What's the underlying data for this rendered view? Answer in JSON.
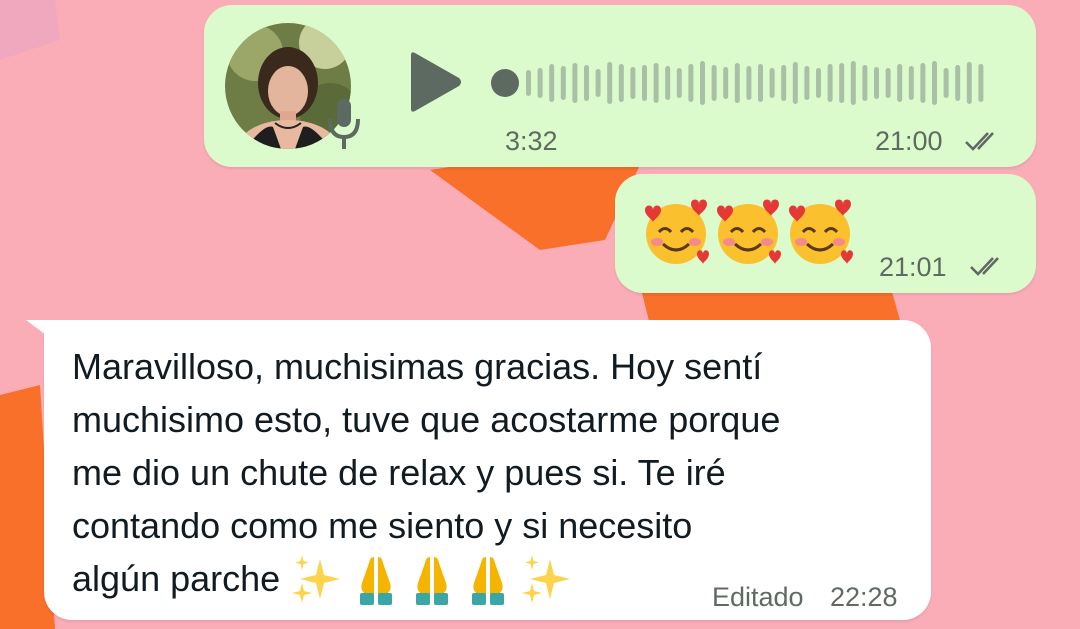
{
  "colors": {
    "background": "#fbadb7",
    "orange_shape": "#f9702a",
    "outgoing_bubble": "#dcfbcc",
    "incoming_bubble": "#ffffff",
    "meta_text": "#5f6b62",
    "waveform": "#a9bfa6",
    "play_icon": "#5c6a62"
  },
  "messages": [
    {
      "type": "voice",
      "direction": "outgoing",
      "duration": "3:32",
      "time": "21:00",
      "status_icon": "double-check-icon",
      "avatar_icon": "profile-photo",
      "badge_icon": "microphone-icon",
      "control_icon": "play-icon"
    },
    {
      "type": "emoji",
      "direction": "outgoing",
      "emoji": [
        "smiling-face-with-hearts-icon",
        "smiling-face-with-hearts-icon",
        "smiling-face-with-hearts-icon"
      ],
      "time": "21:01",
      "status_icon": "double-check-icon"
    },
    {
      "type": "text",
      "direction": "incoming",
      "text": "Maravilloso, muchisimas gracias. Hoy sentí\nmuchisimo esto, tuve que acostarme porque\nme dio un chute de relax y pues si. Te iré\ncontando como me siento y si necesito\nalgún parche ",
      "trailing_emoji": [
        "sparkles-icon",
        "folded-hands-icon",
        "folded-hands-icon",
        "folded-hands-icon",
        "sparkles-icon"
      ],
      "edited_label": "Editado",
      "time": "22:28"
    }
  ]
}
